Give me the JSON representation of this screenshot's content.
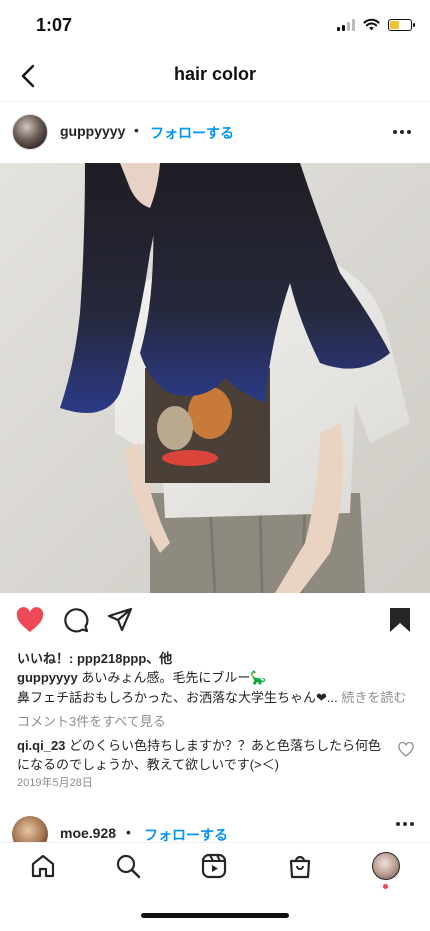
{
  "status_bar": {
    "time": "1:07",
    "battery_color": "#f2c230"
  },
  "header": {
    "title": "hair color",
    "back_icon": "chevron-left-icon"
  },
  "post": {
    "username": "guppyyyy",
    "separator": "•",
    "follow_label": "フォローする",
    "more_icon": "more-horizontal-icon",
    "photo_description_icon": "photo",
    "liked": true,
    "likes_text": "いいね！: ppp218ppp、他",
    "caption_username": "guppyyyy",
    "caption_line1": "あいみょん感。毛先にブルー🦕",
    "caption_line2": "鼻フェチ話おもしろかった、お洒落な大学生ちゃん❤︎...",
    "caption_more": "続きを読む",
    "view_comments": "コメント3件をすべて見る",
    "comment_username": "qi.qi_23",
    "comment_text": "どのくらい色持ちしますか？？あと色落ちしたら何色になるのでしょうか、教えて欲しいです(>＜)",
    "date": "2019年5月28日"
  },
  "next_post": {
    "username": "moe.928",
    "separator": "•",
    "follow_label": "フォローする"
  },
  "bottom_nav": {
    "items": [
      "home-icon",
      "search-icon",
      "reels-icon",
      "shop-icon",
      "profile-avatar"
    ]
  },
  "colors": {
    "accent": "#0095f6",
    "like": "#ed4956",
    "text": "#262626",
    "muted": "#8e8e8e"
  }
}
